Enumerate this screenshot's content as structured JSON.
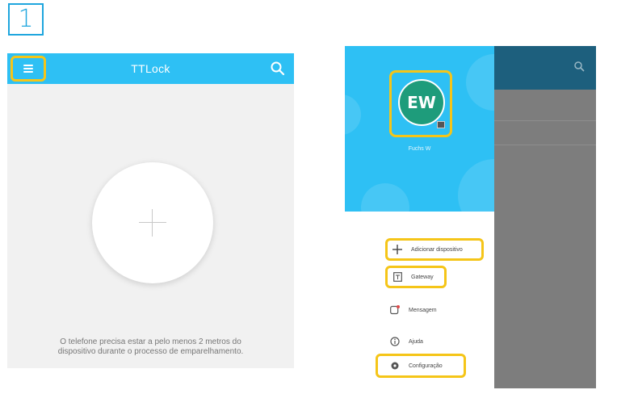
{
  "step": {
    "number": "1"
  },
  "left_screen": {
    "title": "TTLock",
    "hint_line1": "O telefone precisa estar a pelo menos 2 metros do",
    "hint_line2": "dispositivo durante o processo de emparelhamento."
  },
  "right_screen": {
    "avatar_initials": "EW",
    "username": "Fuchs W",
    "menu": [
      {
        "label": "Adicionar dispositivo",
        "icon": "plus-icon"
      },
      {
        "label": "Gateway",
        "icon": "gateway-icon"
      },
      {
        "label": "Mensagem",
        "icon": "message-icon"
      },
      {
        "label": "Ajuda",
        "icon": "help-icon"
      },
      {
        "label": "Configuração",
        "icon": "settings-gear-icon"
      }
    ]
  },
  "colors": {
    "app_blue": "#2ec0f4",
    "highlight": "#f5c518",
    "badge_blue": "#1fa6de",
    "avatar_green": "#1e9c7b"
  }
}
